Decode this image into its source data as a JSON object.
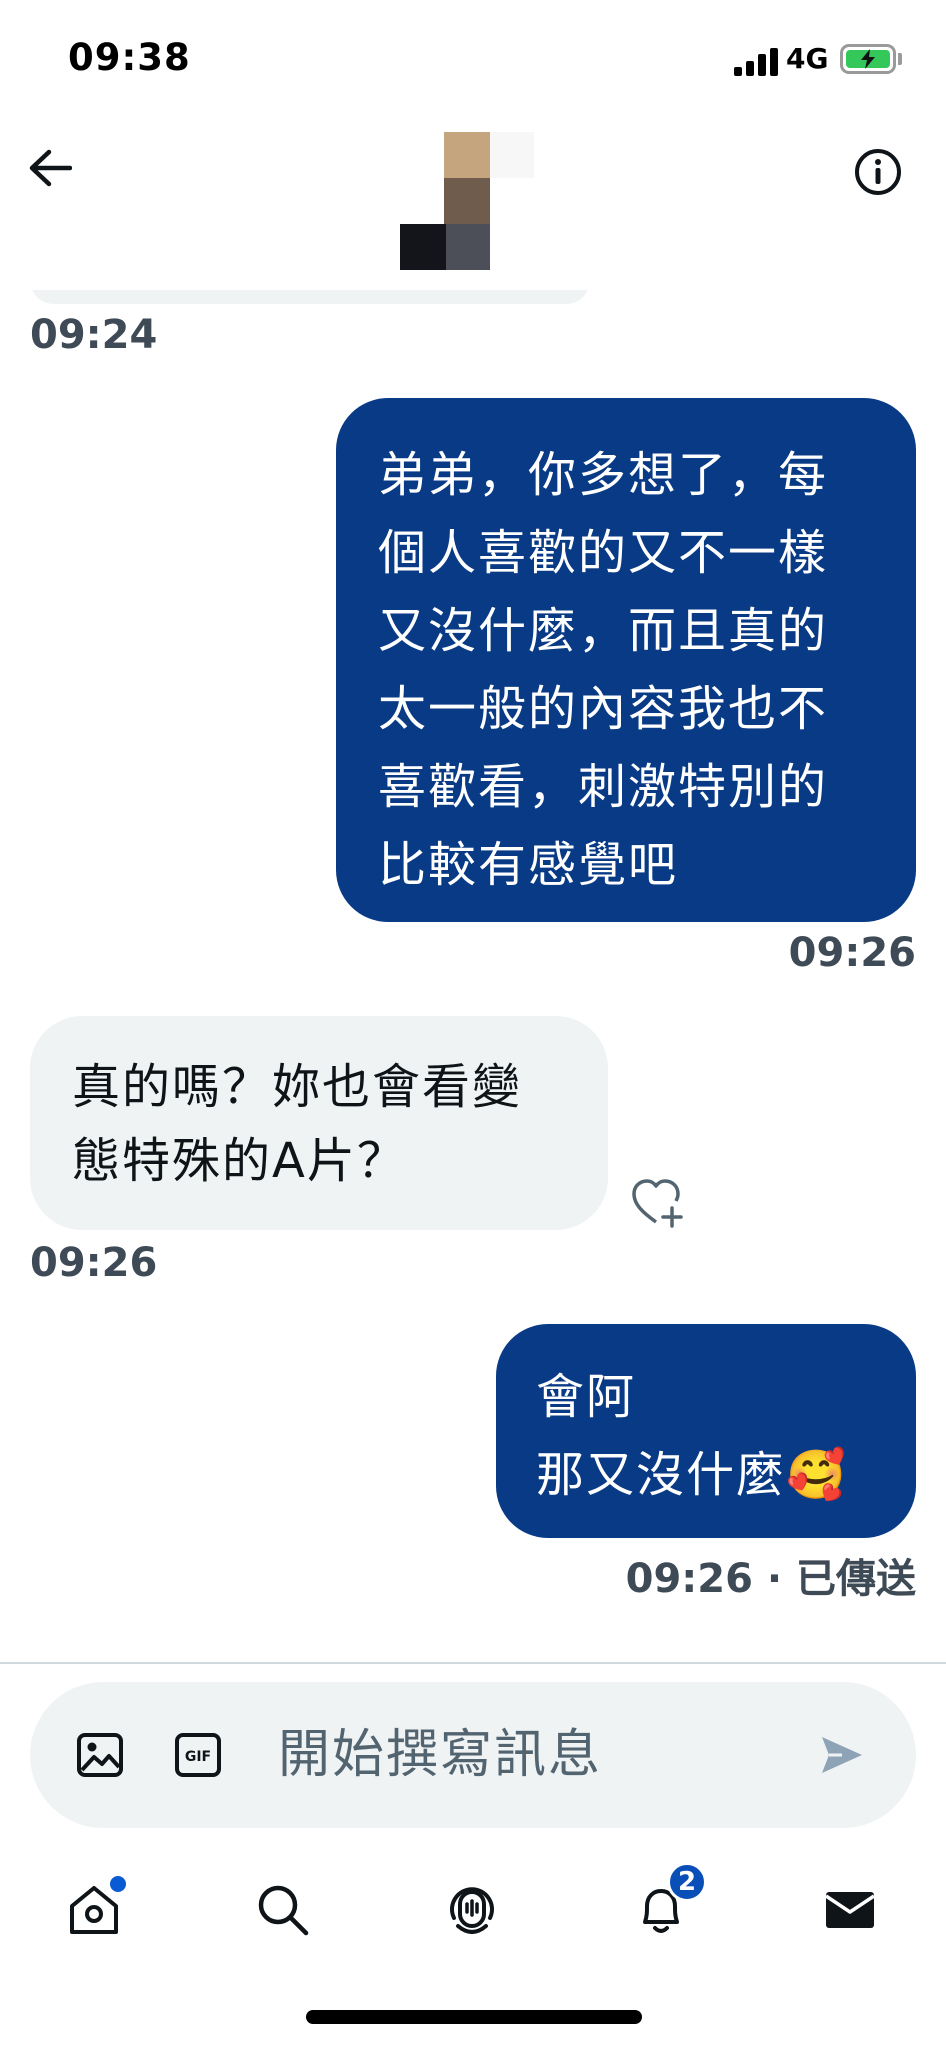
{
  "status_bar": {
    "time": "09:38",
    "network": "4G"
  },
  "messages": [
    {
      "direction": "in",
      "text": "",
      "timestamp": "09:24"
    },
    {
      "direction": "out",
      "text": "弟弟，你多想了，每\n個人喜歡的又不一樣\n又沒什麼，而且真的\n太一般的內容我也不\n喜歡看，刺激特別的\n比較有感覺吧",
      "timestamp": "09:26"
    },
    {
      "direction": "in",
      "text": "真的嗎？妳也會看變\n態特殊的A片？",
      "timestamp": "09:26"
    },
    {
      "direction": "out",
      "text": "會阿\n那又沒什麼🥰",
      "timestamp": "09:26 · 已傳送"
    }
  ],
  "composer": {
    "placeholder": "開始撰寫訊息"
  },
  "nav": {
    "notification_count": "2"
  },
  "colors": {
    "outgoing_bubble": "#083a85",
    "incoming_bubble": "#eff3f4"
  }
}
